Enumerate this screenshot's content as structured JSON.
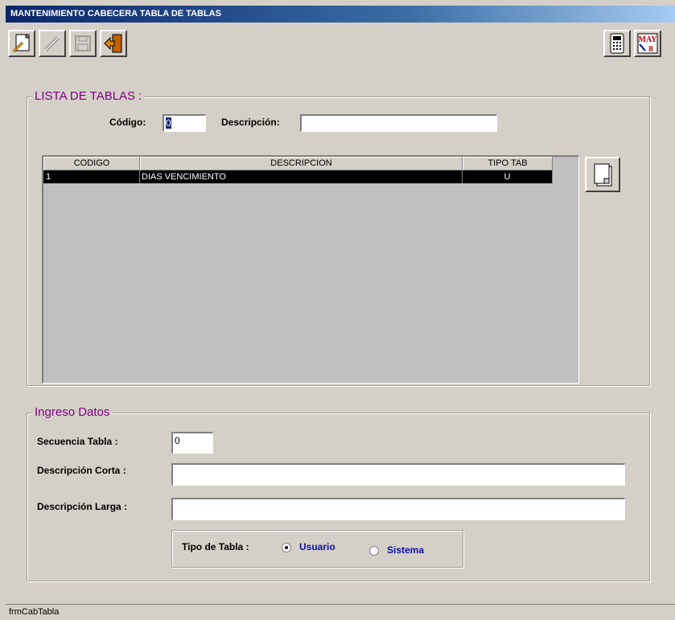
{
  "window": {
    "title": "MANTENIMIENTO CABECERA  TABLA DE TABLAS"
  },
  "toolbar": {
    "items": [
      {
        "name": "new-record",
        "icon": "new-document-pencil-icon",
        "enabled": true
      },
      {
        "name": "edit-record",
        "icon": "pencil-icon",
        "enabled": false
      },
      {
        "name": "save-record",
        "icon": "floppy-disk-icon",
        "enabled": false
      },
      {
        "name": "exit",
        "icon": "exit-door-icon",
        "enabled": true
      }
    ],
    "right_items": [
      {
        "name": "calculator",
        "icon": "calculator-icon"
      },
      {
        "name": "calendar",
        "icon": "calendar-icon",
        "text_month": "MAY",
        "text_day": "8"
      }
    ]
  },
  "lista": {
    "legend": "LISTA DE TABLAS :",
    "codigo_label": "Código:",
    "codigo_value": "0",
    "descripcion_label": "Descripción:",
    "descripcion_value": "",
    "grid": {
      "columns": [
        "CODIGO",
        "DESCRIPCION",
        "TIPO TAB"
      ],
      "rows": [
        {
          "codigo": "1",
          "descripcion": "DIAS VENCIMIENTO",
          "tipo": "U",
          "selected": true
        }
      ]
    }
  },
  "ingreso": {
    "legend": "Ingreso Datos",
    "secuencia_label": "Secuencia Tabla :",
    "secuencia_value": "0",
    "desc_corta_label": "Descripción Corta :",
    "desc_corta_value": "",
    "desc_larga_label": "Descripción Larga :",
    "desc_larga_value": "",
    "tipo_label": "Tipo de Tabla :",
    "options": [
      {
        "label": "Usuario",
        "selected": true
      },
      {
        "label": "Sistema",
        "selected": false
      }
    ]
  },
  "status": {
    "text": "frmCabTabla"
  },
  "colors": {
    "title_start": "#0a246a",
    "title_end": "#a6caf0",
    "legend": "#800080",
    "option_text": "#1010a0",
    "selection": "#000000"
  }
}
